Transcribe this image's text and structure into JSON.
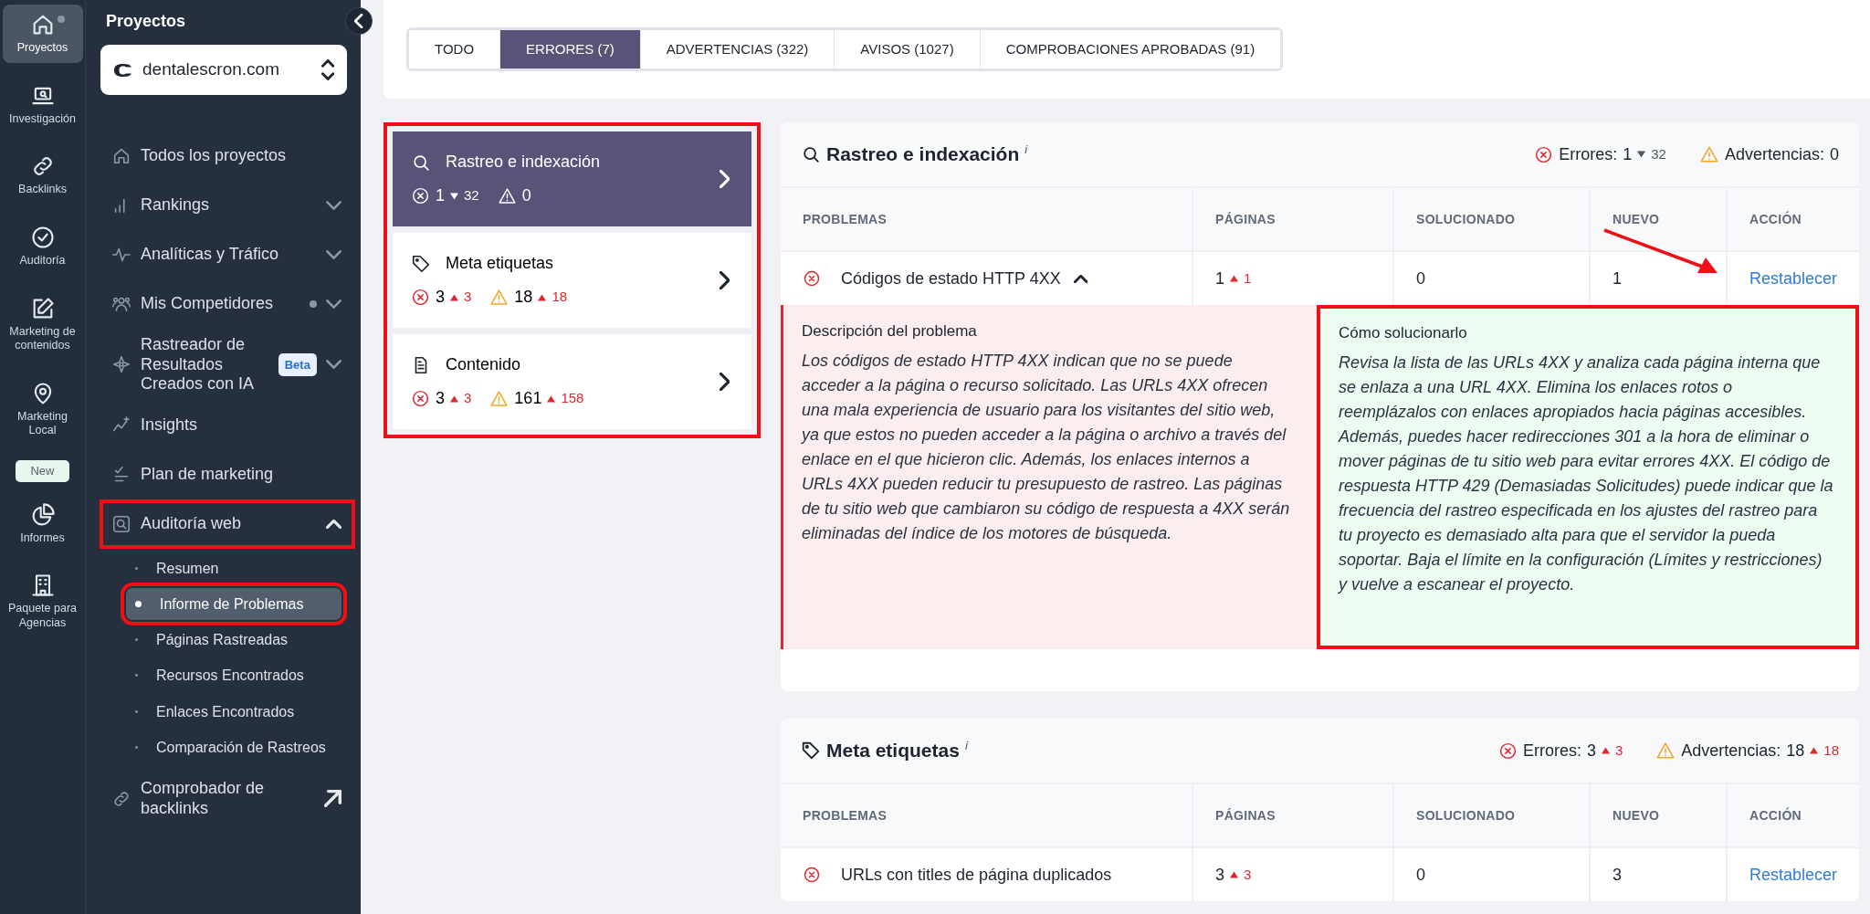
{
  "rail": [
    {
      "label": "Proyectos",
      "selected": true,
      "dot": true
    },
    {
      "label": "Investigación",
      "selected": false
    },
    {
      "label": "Backlinks",
      "selected": false
    },
    {
      "label": "Auditoría",
      "selected": false
    },
    {
      "label": "Marketing de contenidos",
      "selected": false
    },
    {
      "label": "Marketing Local",
      "selected": false,
      "badge": "New"
    },
    {
      "label": "Informes",
      "selected": false
    },
    {
      "label": "Paquete para Agencias",
      "selected": false
    }
  ],
  "sidebar": {
    "title": "Proyectos",
    "project": "dentalescron.com",
    "items": [
      {
        "label": "Todos los proyectos"
      },
      {
        "label": "Rankings",
        "expanded": false
      },
      {
        "label": "Analíticas y Tráfico",
        "expanded": false
      },
      {
        "label": "Mis Competidores",
        "expanded": false,
        "dot": true
      },
      {
        "label": "Rastreador de Resultados Creados con IA",
        "expanded": false,
        "badge": "Beta"
      },
      {
        "label": "Insights"
      },
      {
        "label": "Plan de marketing"
      },
      {
        "label": "Auditoría web",
        "expanded": true,
        "highlighted": true,
        "children": [
          {
            "label": "Resumen",
            "selected": false,
            "highlighted": false
          },
          {
            "label": "Informe de Problemas",
            "selected": true,
            "highlighted": true
          },
          {
            "label": "Páginas Rastreadas",
            "selected": false,
            "highlighted": false
          },
          {
            "label": "Recursos Encontrados",
            "selected": false,
            "highlighted": false
          },
          {
            "label": "Enlaces Encontrados",
            "selected": false,
            "highlighted": false
          },
          {
            "label": "Comparación de Rastreos",
            "selected": false,
            "highlighted": false
          }
        ]
      },
      {
        "label": "Comprobador de backlinks",
        "external": true
      }
    ]
  },
  "tabs": [
    {
      "label": "TODO",
      "selected": false
    },
    {
      "label": "ERRORES (7)",
      "selected": true
    },
    {
      "label": "ADVERTENCIAS (322)",
      "selected": false
    },
    {
      "label": "AVISOS (1027)",
      "selected": false
    },
    {
      "label": "COMPROBACIONES APROBADAS (91)",
      "selected": false
    }
  ],
  "categories": {
    "highlighted": true,
    "items": [
      {
        "title": "Rastreo e indexación",
        "selected": true,
        "errors": "1",
        "errors_delta": "32",
        "errors_rising": false,
        "warnings": "0"
      },
      {
        "title": "Meta etiquetas",
        "selected": false,
        "errors": "3",
        "errors_delta": "3",
        "errors_rising": true,
        "warnings": "18",
        "warnings_delta": "18",
        "warnings_rising": true
      },
      {
        "title": "Contenido",
        "selected": false,
        "errors": "3",
        "errors_delta": "3",
        "errors_rising": true,
        "warnings": "161",
        "warnings_delta": "158",
        "warnings_rising": true
      }
    ]
  },
  "sections": [
    {
      "title": "Rastreo e indexación",
      "info": "i",
      "errors_label": "Errores:",
      "errors": "1",
      "errors_delta": "32",
      "errors_rising": false,
      "warnings_label": "Advertencias:",
      "warnings": "0",
      "columns": [
        "PROBLEMAS",
        "PÁGINAS",
        "SOLUCIONADO",
        "NUEVO",
        "ACCIÓN"
      ],
      "rows": [
        {
          "problem": "Códigos de estado HTTP 4XX",
          "expanded": true,
          "pages": "1",
          "pages_delta": "1",
          "pages_rising": true,
          "fixed": "0",
          "new": "1",
          "action": "Restablecer",
          "arrow": true,
          "description": {
            "title": "Descripción del problema",
            "text": "Los códigos de estado HTTP 4XX indican que no se puede acceder a la página o recurso solicitado. Las URLs 4XX ofrecen una mala experiencia de usuario para los visitantes del sitio web, ya que estos no pueden acceder a la página o archivo a través del enlace en el que hicieron clic. Además, los enlaces internos a URLs 4XX pueden reducir tu presupuesto de rastreo. Las páginas de tu sitio web que cambiaron su código de respuesta a 4XX serán eliminadas del índice de los motores de búsqueda."
          },
          "fix": {
            "title": "Cómo solucionarlo",
            "highlighted": true,
            "text": "Revisa la lista de las URLs 4XX y analiza cada página interna que se enlaza a una URL 4XX. Elimina los enlaces rotos o reemplázalos con enlaces apropiados hacia páginas accesibles. Además, puedes hacer redirecciones 301 a la hora de eliminar o mover páginas de tu sitio web para evitar errores 4XX. El código de respuesta HTTP 429 (Demasiadas Solicitudes) puede indicar que la frecuencia del rastreo especificada en los ajustes del rastreo para tu proyecto es demasiado alta para que el servidor la pueda soportar. Baja el límite en la configuración (Límites y restricciones) y vuelve a escanear el proyecto."
          }
        }
      ]
    },
    {
      "title": "Meta etiquetas",
      "info": "i",
      "errors_label": "Errores:",
      "errors": "3",
      "errors_delta": "3",
      "errors_rising": true,
      "warnings_label": "Advertencias:",
      "warnings": "18",
      "warnings_delta": "18",
      "warnings_rising": true,
      "columns": [
        "PROBLEMAS",
        "PÁGINAS",
        "SOLUCIONADO",
        "NUEVO",
        "ACCIÓN"
      ],
      "rows": [
        {
          "problem": "URLs con titles de página duplicados",
          "pages": "3",
          "pages_delta": "3",
          "pages_rising": true,
          "fixed": "0",
          "new": "3",
          "action": "Restablecer"
        }
      ]
    }
  ]
}
